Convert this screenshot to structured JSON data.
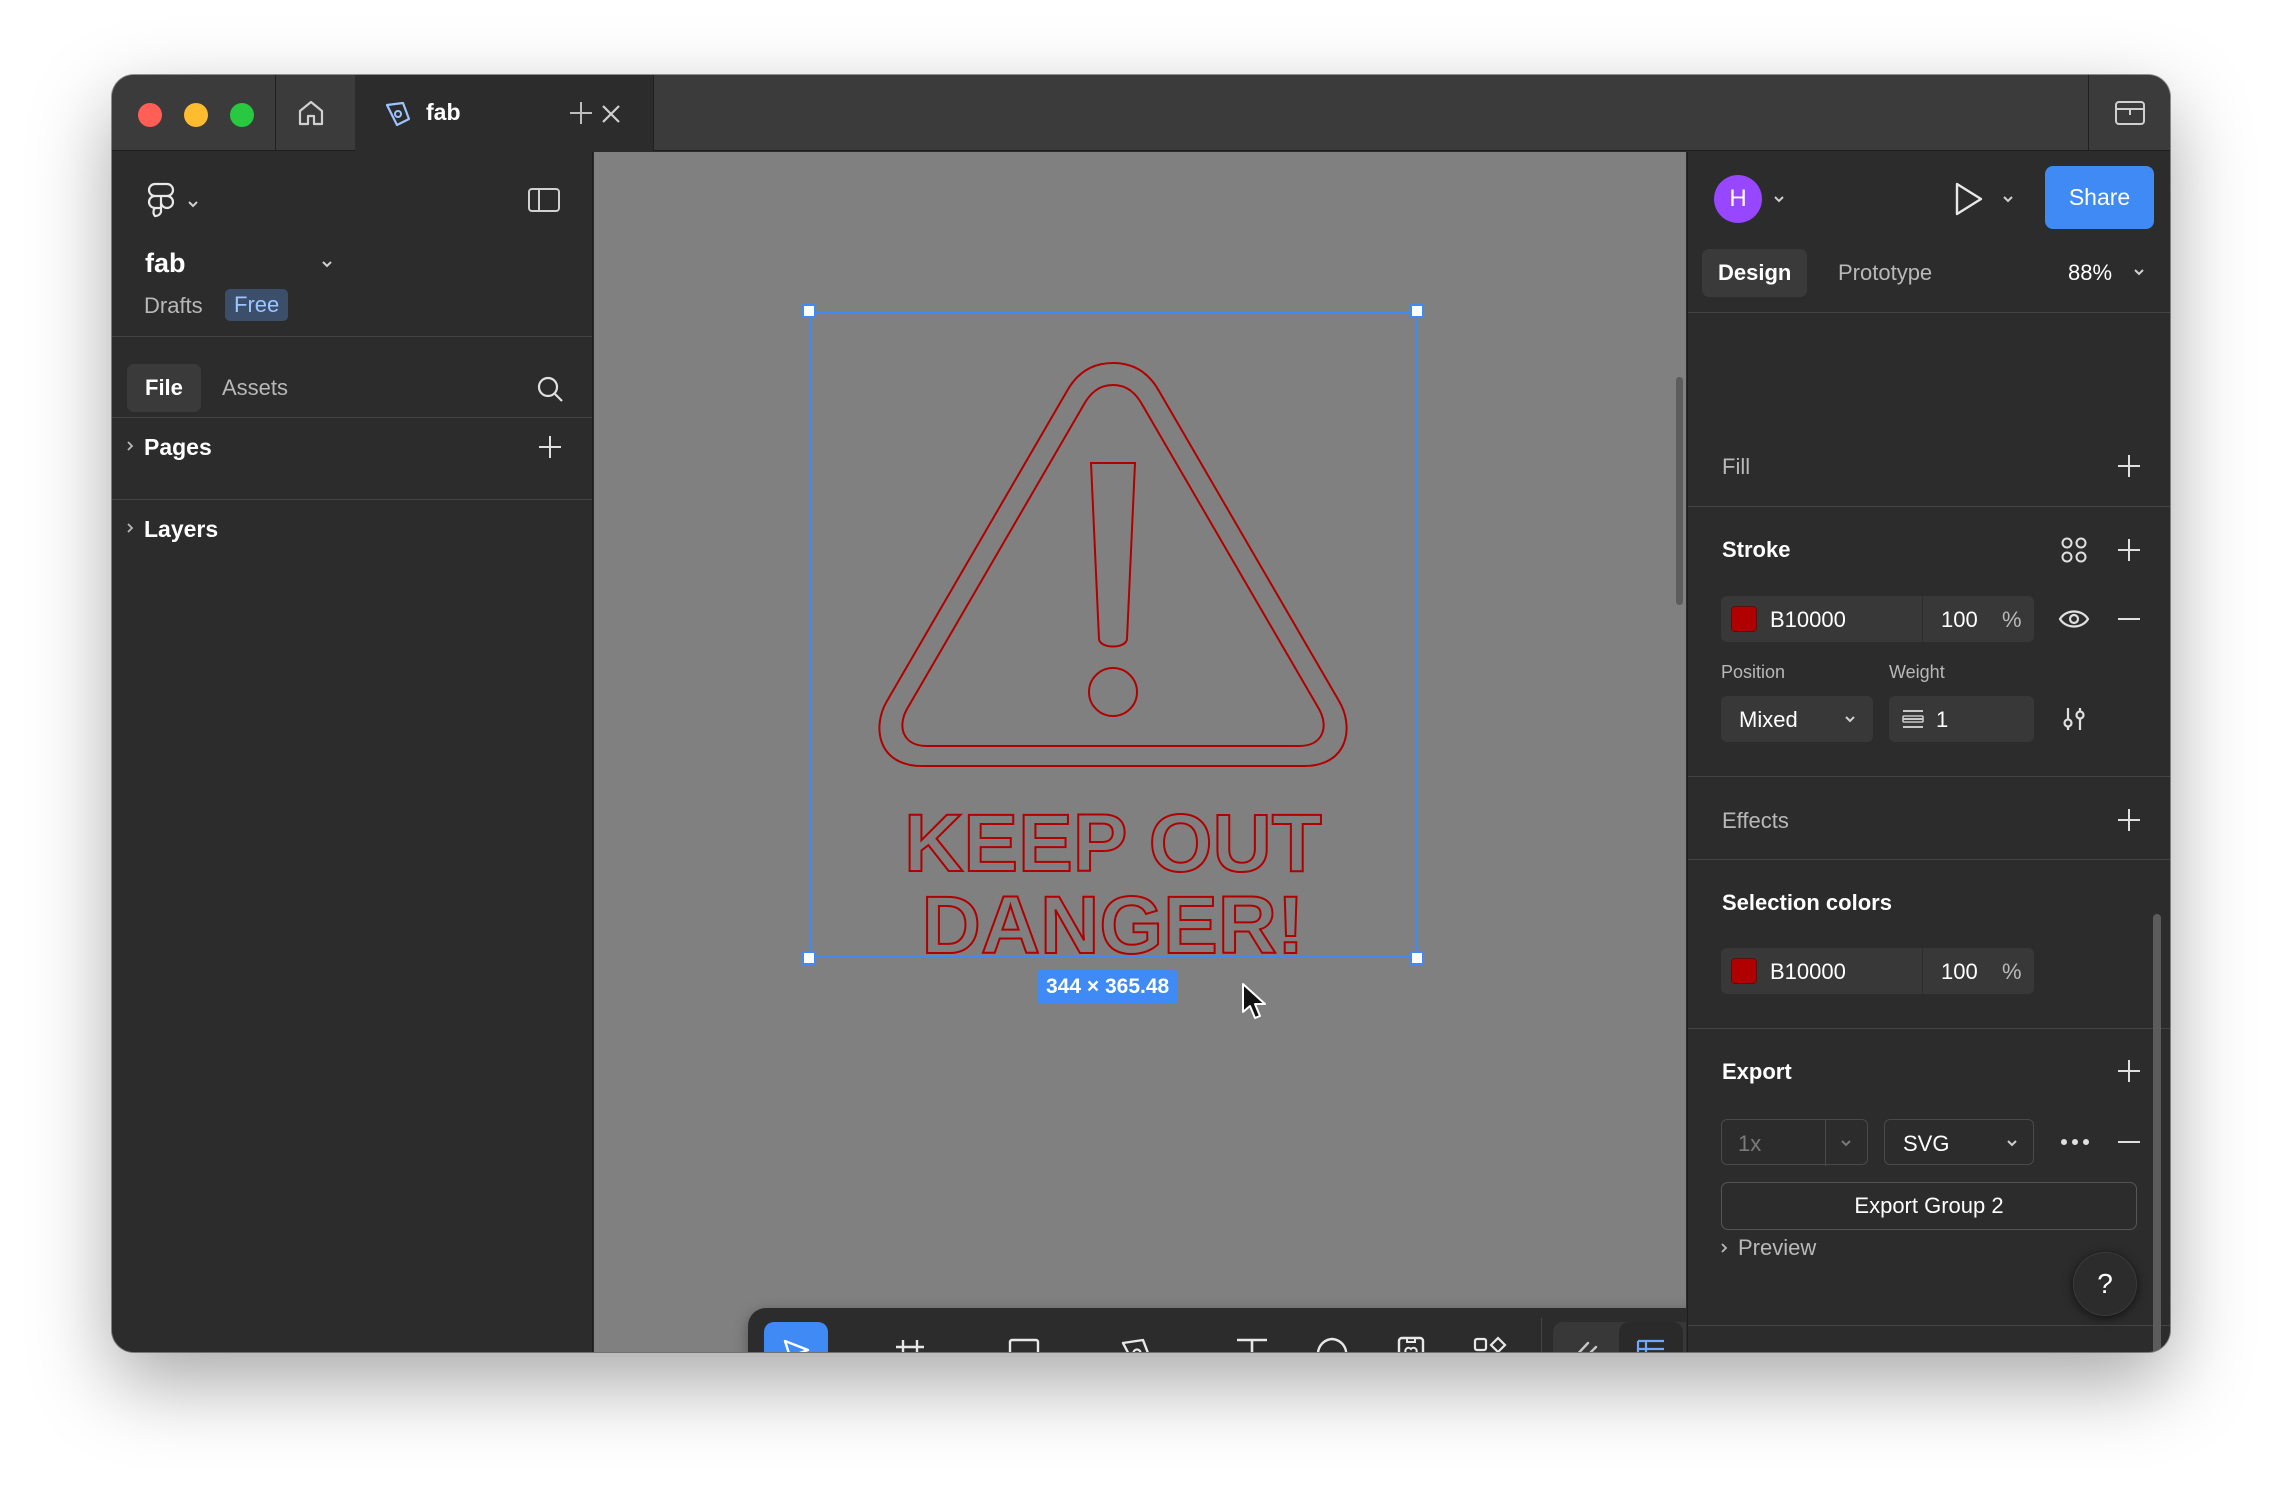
{
  "titlebar": {
    "tab_title": "fab"
  },
  "left_panel": {
    "file_name": "fab",
    "location": "Drafts",
    "plan_badge": "Free",
    "tabs": {
      "file": "File",
      "assets": "Assets"
    },
    "sections": {
      "pages": "Pages",
      "layers": "Layers"
    }
  },
  "canvas": {
    "selection_dimensions": "344 × 365.48",
    "artwork_text_line1": "KEEP OUT",
    "artwork_text_line2": "DANGER!"
  },
  "right_panel": {
    "avatar_initial": "H",
    "share_label": "Share",
    "tabs": {
      "design": "Design",
      "prototype": "Prototype"
    },
    "zoom": "88%",
    "fill": {
      "title": "Fill"
    },
    "stroke": {
      "title": "Stroke",
      "color_hex": "B10000",
      "opacity": "100",
      "percent": "%",
      "position_label": "Position",
      "position_value": "Mixed",
      "weight_label": "Weight",
      "weight_value": "1"
    },
    "effects": {
      "title": "Effects"
    },
    "selection_colors": {
      "title": "Selection colors",
      "color_hex": "B10000",
      "opacity": "100",
      "percent": "%"
    },
    "export": {
      "title": "Export",
      "scale": "1x",
      "format": "SVG",
      "button_label": "Export Group 2",
      "preview_label": "Preview"
    },
    "help": "?"
  },
  "colors": {
    "accent": "#3f8af5",
    "stroke": "#b10000",
    "avatar": "#9747ff",
    "canvas_bg": "#808080",
    "panel_bg": "#2c2c2c"
  },
  "icons": [
    "home-icon",
    "pen-tab-icon",
    "close-icon",
    "plus-icon",
    "figma-logo-icon",
    "sidebar-toggle-icon",
    "search-icon",
    "move-tool-icon",
    "frame-tool-icon",
    "rectangle-tool-icon",
    "pen-tool-icon",
    "text-tool-icon",
    "comment-tool-icon",
    "widget-tool-icon",
    "actions-tool-icon",
    "draw-mode-icon",
    "design-mode-icon",
    "dev-mode-icon",
    "play-icon",
    "styles-grid-icon",
    "eye-icon",
    "minus-icon",
    "stroke-settings-icon",
    "more-icon",
    "help-icon"
  ]
}
